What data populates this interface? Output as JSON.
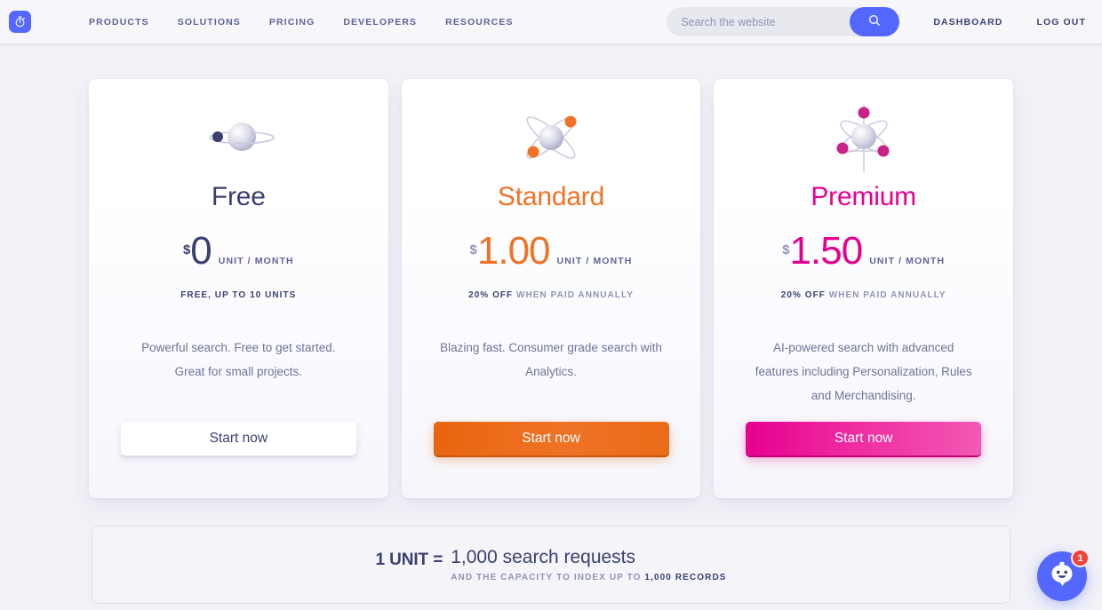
{
  "header": {
    "logo_icon": "stopwatch-icon",
    "nav": [
      {
        "label": "PRODUCTS"
      },
      {
        "label": "SOLUTIONS"
      },
      {
        "label": "PRICING"
      },
      {
        "label": "DEVELOPERS"
      },
      {
        "label": "RESOURCES"
      }
    ],
    "search": {
      "placeholder": "Search the website",
      "value": "",
      "button_icon": "search-icon"
    },
    "dashboard_label": "DASHBOARD",
    "logout_label": "LOG OUT"
  },
  "plans": [
    {
      "name": "Free",
      "name_color": "#3a416f",
      "icon": "planet-one-moon-icon",
      "currency": "$",
      "amount": "0",
      "unit": "UNIT / MONTH",
      "note_bold_prefix": "FREE, UP TO ",
      "note_plain": "",
      "note_bold_suffix": "10 UNITS",
      "description": "Powerful search. Free to get started. Great for small projects.",
      "cta_label": "Start now",
      "accent": "#3a416f"
    },
    {
      "name": "Standard",
      "name_color": "#ef7326",
      "icon": "atom-two-electrons-icon",
      "currency": "$",
      "amount": "1.00",
      "unit": "UNIT / MONTH",
      "note_bold_prefix": "20% OFF",
      "note_plain": " WHEN PAID ANNUALLY",
      "note_bold_suffix": "",
      "description": "Blazing fast. Consumer grade search with Analytics.",
      "cta_label": "Start now",
      "accent": "#ef7326"
    },
    {
      "name": "Premium",
      "name_color": "#e6008f",
      "icon": "atom-three-electrons-icon",
      "currency": "$",
      "amount": "1.50",
      "unit": "UNIT / MONTH",
      "note_bold_prefix": "20% OFF",
      "note_plain": " WHEN PAID ANNUALLY",
      "note_bold_suffix": "",
      "description": "AI-powered search with advanced features including Personalization, Rules and Merchandising.",
      "cta_label": "Start now",
      "accent": "#e6008f"
    }
  ],
  "banner": {
    "lead": "1 UNIT =",
    "main": "1,000 search requests",
    "sub_plain": "AND THE CAPACITY TO INDEX UP TO ",
    "sub_bold": "1,000 RECORDS"
  },
  "chat": {
    "icon": "chat-bubble-face-icon",
    "badge_count": "1"
  },
  "colors": {
    "brand_blue": "#5468ff",
    "ink": "#3a416f",
    "muted": "#8f94b6",
    "page_bg": "#f1f1f7",
    "standard_orange": "#ef7326",
    "premium_pink": "#e6008f",
    "badge_red": "#f0443b"
  }
}
